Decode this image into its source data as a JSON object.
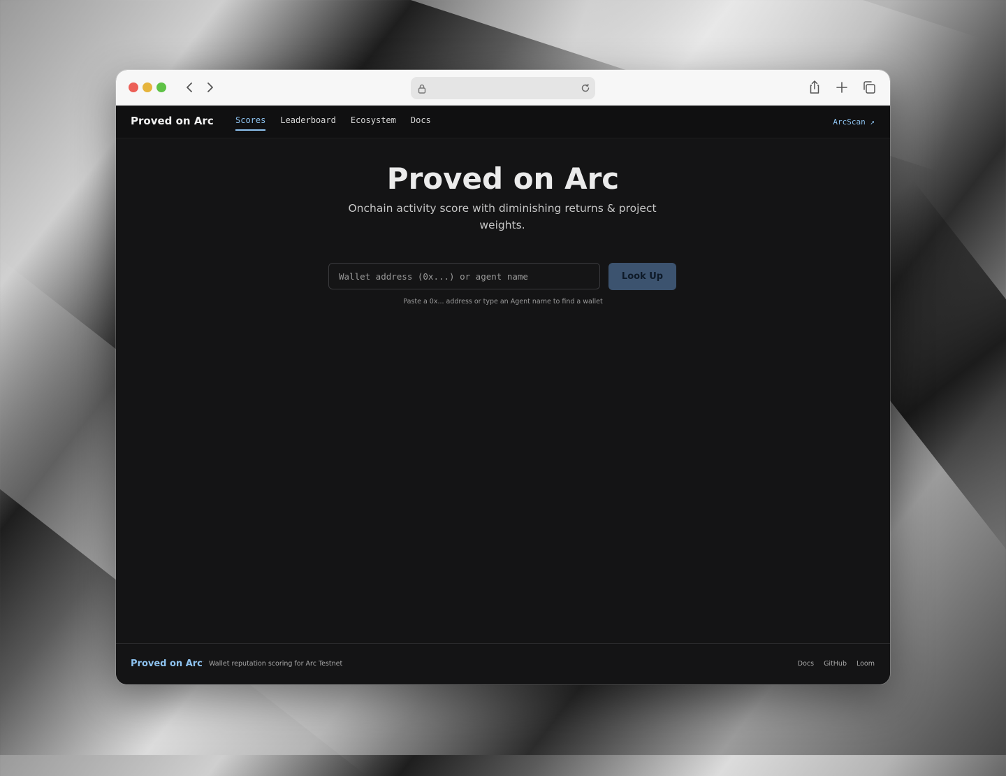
{
  "browser": {
    "url": "",
    "icons": [
      "lock-icon",
      "reload-icon",
      "share-icon",
      "new-tab-icon",
      "tabs-overview-icon",
      "back-icon",
      "forward-icon"
    ]
  },
  "nav": {
    "brand": "Proved on Arc",
    "links": [
      "Scores",
      "Leaderboard",
      "Ecosystem",
      "Docs"
    ],
    "active": "Scores",
    "external": "ArcScan ↗"
  },
  "hero": {
    "title": "Proved on Arc",
    "subtitle": "Onchain activity score with diminishing returns & project weights."
  },
  "search": {
    "placeholder": "Wallet address (0x...) or agent name",
    "value": "",
    "button": "Look Up",
    "hint": "Paste a 0x... address or type an Agent name to find a wallet"
  },
  "footer": {
    "brand": "Proved on Arc",
    "separator": "·",
    "tagline": "Wallet reputation scoring for Arc Testnet",
    "links": [
      "Docs",
      "GitHub",
      "Loom"
    ]
  },
  "colors": {
    "accent": "#8ec3f0",
    "background": "#141415",
    "button": "#3c536f"
  }
}
